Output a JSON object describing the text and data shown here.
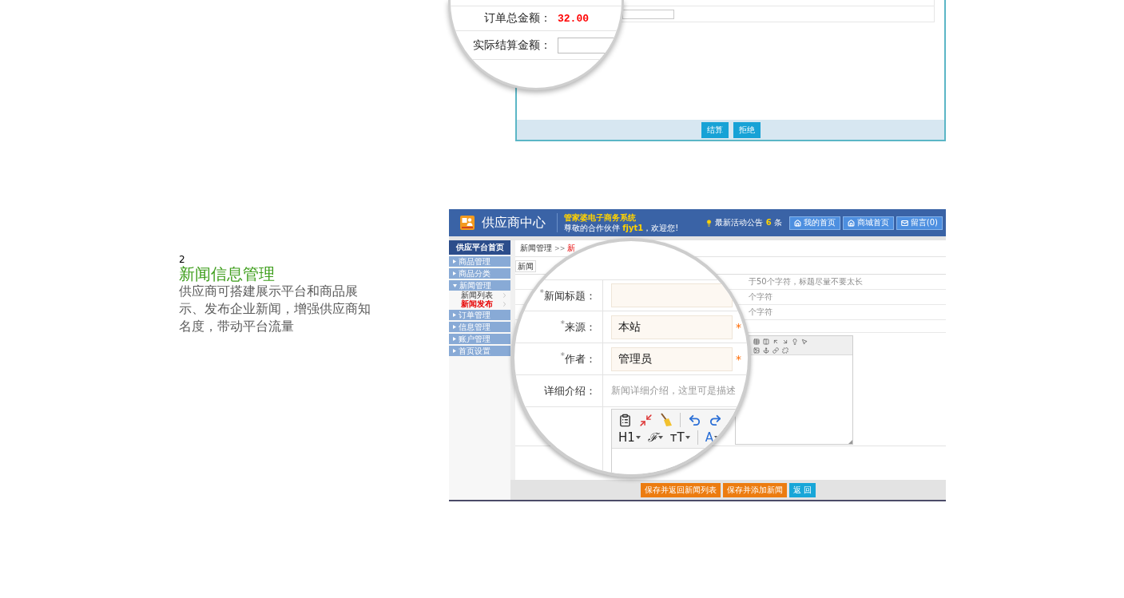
{
  "order_panel": {
    "magnifier_rows": [
      {
        "label": "订单总金额：",
        "kind": "amount",
        "value": "32.00"
      },
      {
        "label": "实际结算金额：",
        "kind": "input"
      }
    ],
    "buttons": [
      "结算",
      "拒绝"
    ]
  },
  "feature": {
    "number": "2",
    "title": "新闻信息管理",
    "description": "供应商可搭建展示平台和商品展示、发布企业新闻，增强供应商知名度，带动平台流量"
  },
  "news_screen": {
    "header": {
      "title": "供应商中心",
      "system_name": "管家婆电子商务系统",
      "greeting": "尊敬的合作伙伴 **fjyt1**，欢迎您!",
      "notice": "最新活动公告 **6** 条",
      "buttons": [
        {
          "label": "我的首页",
          "kind": "home"
        },
        {
          "label": "商城首页",
          "kind": "home"
        },
        {
          "label": "留言(0)",
          "kind": "mail"
        }
      ]
    },
    "sidebar": {
      "title": "供应平台首页",
      "items": [
        {
          "label": "商品管理",
          "expanded": false
        },
        {
          "label": "商品分类",
          "expanded": false
        },
        {
          "label": "新闻管理",
          "expanded": true,
          "children": [
            {
              "label": "新闻列表",
              "selected": false
            },
            {
              "label": "新闻发布",
              "selected": true
            }
          ]
        },
        {
          "label": "订单管理",
          "expanded": false
        },
        {
          "label": "信息管理",
          "expanded": false
        },
        {
          "label": "账户管理",
          "expanded": false
        },
        {
          "label": "首页设置",
          "expanded": false
        }
      ]
    },
    "breadcrumb": {
      "parent": "新闻管理",
      "separator": ">>",
      "current": "新"
    },
    "tab": "新闻",
    "hints": [
      "于50个字符，标题尽量不要太长",
      "个字符",
      "个字符"
    ],
    "magnifier_fields": [
      {
        "label": "$^{*}$新闻标题：",
        "kind": "input"
      },
      {
        "label": "$^{*}$来源：",
        "kind": "input",
        "value": "本站",
        "note": "*"
      },
      {
        "label": "$^{*}$作者：",
        "kind": "input",
        "value": "管理员",
        "note": "*"
      },
      {
        "label": "详细介绍：",
        "kind": "text",
        "text": "新闻详细介绍，这里可是描述"
      },
      {
        "kind": "editor",
        "tools": [
          {
            "label": "H1",
            "kind": "heading"
          },
          {
            "label": "ℱ",
            "kind": "font"
          },
          {
            "label": "ᴛT",
            "kind": "size"
          },
          {
            "label": "A",
            "kind": "color"
          }
        ]
      }
    ],
    "buttons": [
      {
        "label": "保存并返回新闻列表",
        "kind": "primary"
      },
      {
        "label": "保存并添加新闻",
        "kind": "primary"
      },
      {
        "label": "返 回",
        "kind": "secondary"
      }
    ]
  }
}
